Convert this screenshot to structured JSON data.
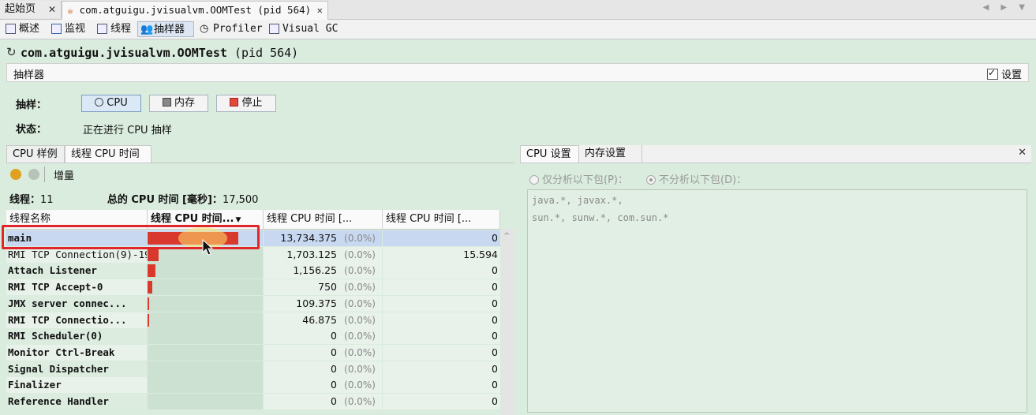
{
  "doc_tabs": [
    {
      "label": "起始页"
    },
    {
      "label": "com.atguigu.jvisualvm.OOMTest (pid 564)"
    }
  ],
  "tool_tabs": [
    "概述",
    "监视",
    "线程",
    "抽样器",
    "Profiler",
    "Visual GC"
  ],
  "app": {
    "name": "com.atguigu.jvisualvm.OOMTest",
    "pid": "(pid 564)"
  },
  "sampler": {
    "panel_label": "抽样器",
    "settings_label": "设置",
    "settings_checked": true,
    "sample_label": "抽样：",
    "buttons": {
      "cpu": "CPU",
      "memory": "内存",
      "stop": "停止"
    },
    "status_label": "状态：",
    "status_value": "正在进行 CPU 抽样"
  },
  "left_tabs": [
    "CPU 样例",
    "线程 CPU 时间"
  ],
  "toolbar": {
    "delta_label": "增量"
  },
  "summary": {
    "threads_label": "线程：",
    "threads_value": "11",
    "total_label": "总的 CPU 时间 [毫秒]：",
    "total_value": "17,500"
  },
  "table": {
    "columns": [
      "线程名称",
      "线程 CPU 时间...",
      "线程 CPU 时间 [...",
      "线程 CPU 时间 [..."
    ],
    "rows": [
      {
        "name": "main",
        "bar_fraction": 0.785,
        "time": "13,734.375",
        "pct": "(0.0%)",
        "delta": "0",
        "bold": true,
        "selected": true
      },
      {
        "name": "RMI TCP Connection(9)-19",
        "bar_fraction": 0.097,
        "time": "1,703.125",
        "pct": "(0.0%)",
        "delta": "15.594",
        "bold": false
      },
      {
        "name": "Attach Listener",
        "bar_fraction": 0.066,
        "time": "1,156.25",
        "pct": "(0.0%)",
        "delta": "0",
        "bold": true
      },
      {
        "name": "RMI TCP Accept-0",
        "bar_fraction": 0.043,
        "time": "750",
        "pct": "(0.0%)",
        "delta": "0",
        "bold": true
      },
      {
        "name": "JMX server connec...",
        "bar_fraction": 0.006,
        "time": "109.375",
        "pct": "(0.0%)",
        "delta": "0",
        "bold": true
      },
      {
        "name": "RMI TCP Connectio...",
        "bar_fraction": 0.003,
        "time": "46.875",
        "pct": "(0.0%)",
        "delta": "0",
        "bold": true
      },
      {
        "name": "RMI Scheduler(0)",
        "bar_fraction": 0,
        "time": "0",
        "pct": "(0.0%)",
        "delta": "0",
        "bold": true
      },
      {
        "name": "Monitor Ctrl-Break",
        "bar_fraction": 0,
        "time": "0",
        "pct": "(0.0%)",
        "delta": "0",
        "bold": true
      },
      {
        "name": "Signal Dispatcher",
        "bar_fraction": 0,
        "time": "0",
        "pct": "(0.0%)",
        "delta": "0",
        "bold": true
      },
      {
        "name": "Finalizer",
        "bar_fraction": 0,
        "time": "0",
        "pct": "(0.0%)",
        "delta": "0",
        "bold": true
      },
      {
        "name": "Reference Handler",
        "bar_fraction": 0,
        "time": "0",
        "pct": "(0.0%)",
        "delta": "0",
        "bold": true
      }
    ]
  },
  "right_tabs": [
    "CPU 设置",
    "内存设置"
  ],
  "filters": {
    "only_label": "仅分析以下包(P)：",
    "exclude_label": "不分析以下包(D)：",
    "lines": [
      "java.*, javax.*,",
      "sun.*, sunw.*, com.sun.*"
    ]
  },
  "colors": {
    "bar": "#d9392c",
    "highlight": "#e0262a",
    "selected_row": "#c7d8f0",
    "background": "#d9ecdd"
  }
}
